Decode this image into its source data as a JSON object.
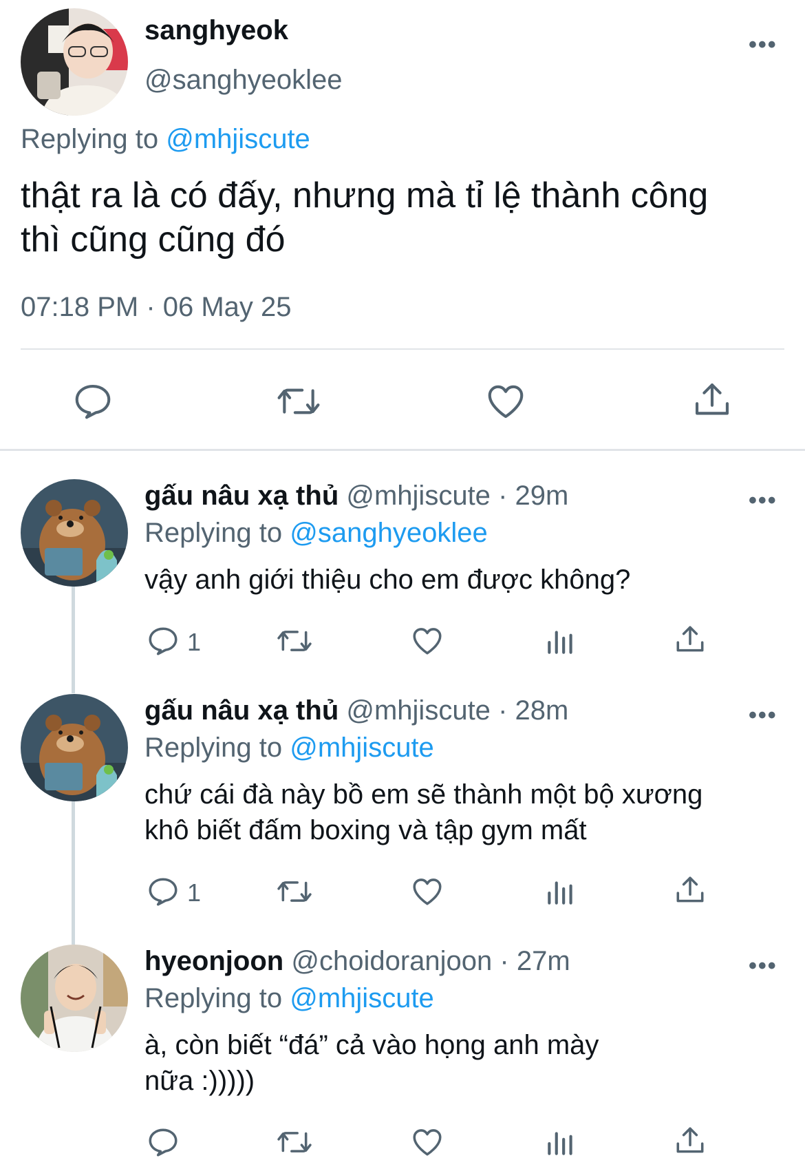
{
  "main_tweet": {
    "name": "sanghyeok",
    "handle": "@sanghyeoklee",
    "replying_prefix": "Replying to",
    "replying_to": "@mhjiscute",
    "text_line1": "thật ra là có đấy, nhưng mà tỉ lệ thành công",
    "text_line2": "thì cũng cũng đó",
    "timestamp": "07:18 PM · 06 May 25",
    "more_glyph": "•••"
  },
  "replies": [
    {
      "name": "gấu nâu xạ thủ",
      "handle": "@mhjiscute",
      "time": "· 29m",
      "replying_prefix": "Replying to",
      "replying_to": "@sanghyeoklee",
      "text_line1": "vậy anh giới thiệu cho em được không?",
      "text_line2": "",
      "reply_count": "1",
      "more_glyph": "•••"
    },
    {
      "name": "gấu nâu xạ thủ",
      "handle": "@mhjiscute",
      "time": "· 28m",
      "replying_prefix": "Replying to",
      "replying_to": "@mhjiscute",
      "text_line1": "chứ cái đà này bồ em sẽ thành một bộ xương",
      "text_line2": "khô biết đấm boxing và tập gym mất",
      "reply_count": "1",
      "more_glyph": "•••"
    },
    {
      "name": "hyeonjoon",
      "handle": "@choidoranjoon",
      "time": "· 27m",
      "replying_prefix": "Replying to",
      "replying_to": "@mhjiscute",
      "text_line1": "à, còn biết “đá” cả vào họng anh mày",
      "text_line2": "nữa :)))))",
      "reply_count": "",
      "more_glyph": "•••"
    }
  ],
  "colors": {
    "link": "#1d9bf0",
    "secondary": "#536471",
    "divider": "#e1e4e8",
    "thread_line": "#cfd9de"
  },
  "icons": [
    "reply-icon",
    "retweet-icon",
    "like-icon",
    "share-icon",
    "views-icon",
    "more-icon"
  ]
}
